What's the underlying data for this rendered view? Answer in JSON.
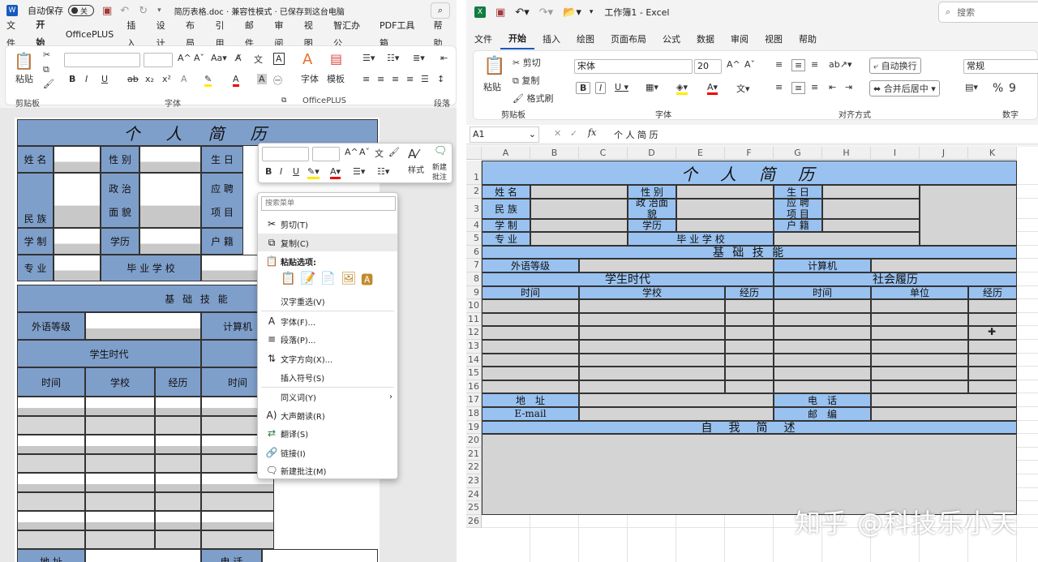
{
  "word": {
    "autosave_label": "自动保存",
    "autosave_state": "关",
    "doc_title": "简历表格.doc · 兼容性模式 · 已保存到这台电脑",
    "tabs": [
      "文件",
      "开始",
      "OfficePLUS",
      "插入",
      "设计",
      "布局",
      "引用",
      "邮件",
      "审阅",
      "视图",
      "智汇办公",
      "PDF工具箱",
      "帮助"
    ],
    "ribbon": {
      "paste": "粘贴",
      "clipboard": "剪贴板",
      "font_group": "字体",
      "officeplus_group": "OfficePLUS",
      "paragraph_group": "段落",
      "font_btn": "字体",
      "template_btn": "模板"
    },
    "resume": {
      "title": "个　人　简　历",
      "name": "姓 名",
      "gender": "性 别",
      "birth": "生 日",
      "politics_1": "政 治",
      "politics_2": "面 貌",
      "apply_1": "应 聘",
      "apply_2": "项 目",
      "ethnic": "民 族",
      "edu_sys": "学 制",
      "degree": "学历",
      "huji": "户 籍",
      "major": "专 业",
      "school": "毕 业 学 校",
      "skills": "基 础 技 能",
      "foreign": "外语等级",
      "computer": "计算机",
      "student": "学生时代",
      "time": "时间",
      "school_col": "学校",
      "exp": "经历",
      "address": "地 址",
      "phone": "电 话"
    },
    "mini_toolbar": {
      "style": "样式",
      "new_comment_1": "新建",
      "new_comment_2": "批注"
    },
    "context_menu": {
      "search_placeholder": "搜索菜单",
      "cut": "剪切(T)",
      "copy": "复制(C)",
      "paste_options": "粘贴选项:",
      "hanzi": "汉字重选(V)",
      "font": "字体(F)...",
      "paragraph": "段落(P)...",
      "text_dir": "文字方向(X)...",
      "insert_symbol": "插入符号(S)",
      "synonym": "同义词(Y)",
      "read_aloud": "大声朗读(R)",
      "translate": "翻译(S)",
      "link": "链接(I)",
      "new_comment": "新建批注(M)"
    }
  },
  "excel": {
    "app_title": "工作簿1 - Excel",
    "search_placeholder": "搜索",
    "tabs": [
      "文件",
      "开始",
      "插入",
      "绘图",
      "页面布局",
      "公式",
      "数据",
      "审阅",
      "视图",
      "帮助"
    ],
    "ribbon": {
      "paste": "粘贴",
      "cut": "剪切",
      "copy": "复制",
      "format_painter": "格式刷",
      "clipboard": "剪贴板",
      "font_name": "宋体",
      "font_size": "20",
      "font_group": "字体",
      "wrap": "自动换行",
      "merge": "合并后居中",
      "align_group": "对齐方式",
      "number_format": "常规",
      "number_group": "数字"
    },
    "name_box": "A1",
    "formula": "个 人 简 历",
    "columns": [
      "A",
      "B",
      "C",
      "D",
      "E",
      "F",
      "G",
      "H",
      "I",
      "J",
      "K"
    ],
    "rows": [
      "1",
      "2",
      "3",
      "4",
      "5",
      "6",
      "7",
      "8",
      "9",
      "10",
      "11",
      "12",
      "13",
      "14",
      "15",
      "16",
      "17",
      "18",
      "19",
      "20",
      "21",
      "22",
      "23",
      "24",
      "25",
      "26"
    ],
    "cells": {
      "title": "个　人　简　历",
      "name": "姓 名",
      "gender": "性 别",
      "birth": "生 日",
      "ethnic": "民 族",
      "politics": "政 治面",
      "politics_2": "貌",
      "apply": "应 聘",
      "apply_2": "项 目",
      "edu_sys": "学 制",
      "degree": "学历",
      "huji": "户 籍",
      "major": "专 业",
      "school": "毕 业 学 校",
      "skills": "基 础 技 能",
      "foreign": "外语等级",
      "computer": "计算机",
      "student": "学生时代",
      "social": "社会履历",
      "time": "时间",
      "school_col": "学校",
      "exp": "经历",
      "unit": "单位",
      "address": "地　址",
      "phone": "电　话",
      "email": "E-mail",
      "post": "邮　编",
      "self": "自　我　简　述"
    }
  },
  "watermark": "知乎 @科技乐小天"
}
